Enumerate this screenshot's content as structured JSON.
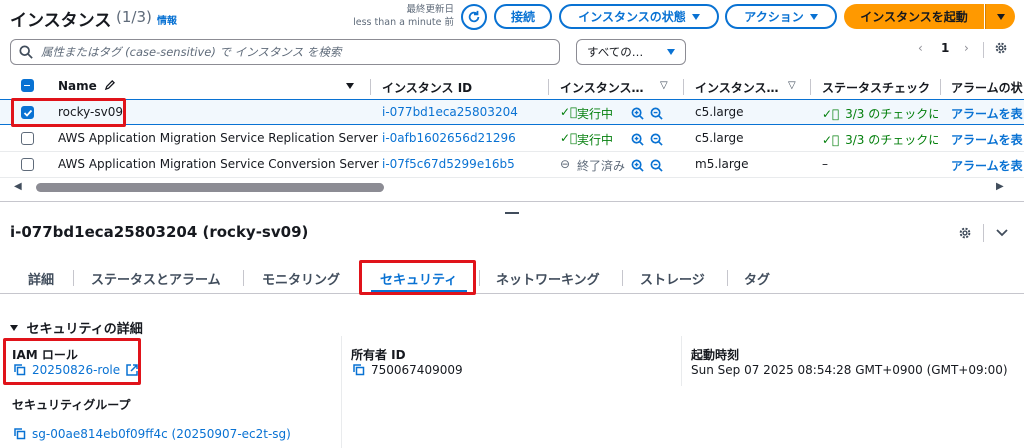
{
  "header": {
    "title": "インスタンス",
    "count": "(1/3)",
    "info": "情報",
    "last_updated_label": "最終更新日",
    "last_updated_value": "less than a minute 前",
    "connect": "接続",
    "instance_state": "インスタンスの状態",
    "actions": "アクション",
    "launch": "インスタンスを起動"
  },
  "search": {
    "placeholder": "属性またはタグ (case-sensitive) で インスタンス を検索",
    "filter_select": "すべての…"
  },
  "pager": {
    "page": "1"
  },
  "table": {
    "columns": [
      "Name",
      "インスタンス ID",
      "インスタンス…",
      "インスタンス…",
      "ステータスチェック",
      "アラームの状"
    ],
    "rows": [
      {
        "name": "rocky-sv09",
        "id": "i-077bd1eca25803204",
        "state": "実行中",
        "type": "c5.large",
        "status": "3/3 のチェックに",
        "alarm": "アラームを表"
      },
      {
        "name": "AWS Application Migration Service Replication Server",
        "id": "i-0afb1602656d21296",
        "state": "実行中",
        "type": "c5.large",
        "status": "3/3 のチェックに",
        "alarm": "アラームを表"
      },
      {
        "name": "AWS Application Migration Service Conversion Server",
        "id": "i-07f5c67d5299e16b5",
        "state": "終了済み",
        "type": "m5.large",
        "status": "–",
        "alarm": "アラームを表"
      }
    ]
  },
  "details": {
    "title": "i-077bd1eca25803204 (rocky-sv09)",
    "tabs": [
      "詳細",
      "ステータスとアラーム",
      "モニタリング",
      "セキュリティ",
      "ネットワーキング",
      "ストレージ",
      "タグ"
    ],
    "section_title": "セキュリティの詳細",
    "iam_role_label": "IAM ロール",
    "iam_role_value": "20250826-role",
    "owner_id_label": "所有者 ID",
    "owner_id_value": "750067409009",
    "launch_time_label": "起動時刻",
    "launch_time_value": "Sun Sep 07 2025 08:54:28 GMT+0900 (GMT+09:00)",
    "sg_label": "セキュリティグループ",
    "sg_value": "sg-00ae814eb0f09ff4c (20250907-ec2t-sg)"
  },
  "colors": {
    "link": "#0972d3",
    "accent": "#ff9900",
    "highlight": "#e0131a",
    "success": "#037f0c"
  }
}
